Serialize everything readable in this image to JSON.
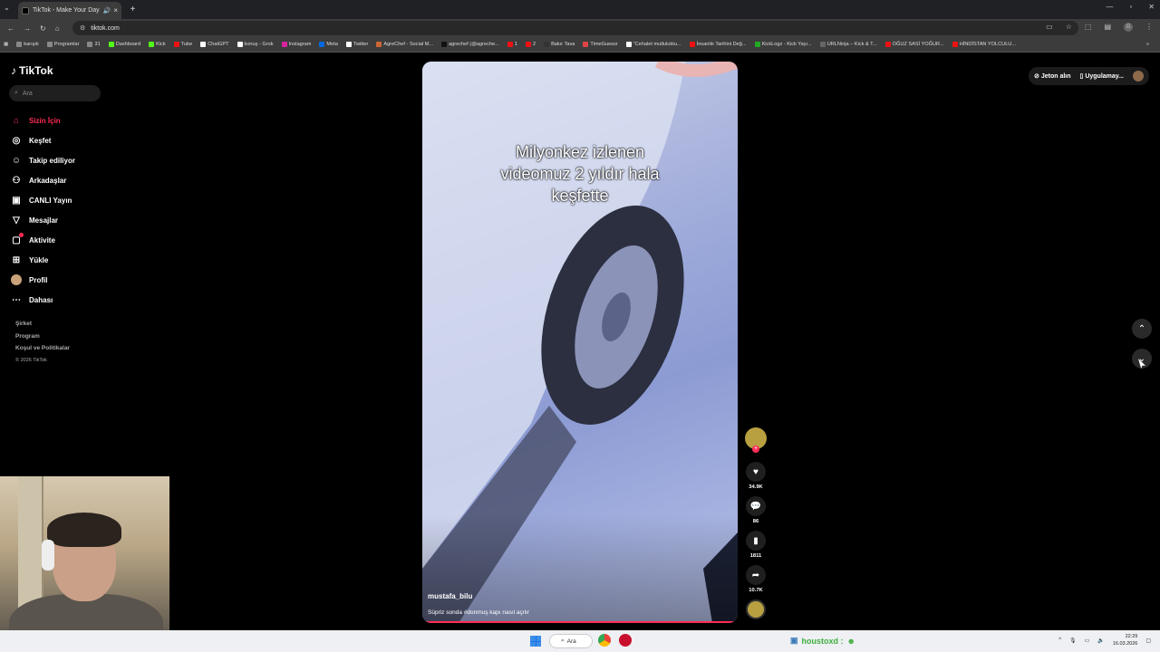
{
  "browser": {
    "tab_title": "TikTok - Make Your Day",
    "url": "tiktok.com",
    "bookmarks": [
      "karışık",
      "Programlar",
      "31",
      "Dashboard",
      "Kick",
      "Tube",
      "ChatGPT",
      "konuş - Grok",
      "Instagram",
      "Meta",
      "Twitter",
      "AgreChef - Social M...",
      "agrechef (@agreche...",
      "1",
      "2",
      "Bakır Tava",
      "TimeGuessr",
      "\"Cehalet mutluluktu...",
      "İnsanlık Tarihini Değ...",
      "KickLogz - Kick Yayı...",
      "URLNinja – Kick & T...",
      "OĞUZ SASİ YOĞUR...",
      "HİNDİSTAN YOLCULU..."
    ]
  },
  "tiktok": {
    "logo": "TikTok",
    "search_placeholder": "Ara",
    "menu": [
      {
        "label": "Sizin İçin",
        "icon": "home-icon"
      },
      {
        "label": "Keşfet",
        "icon": "compass-icon"
      },
      {
        "label": "Takip ediliyor",
        "icon": "following-icon"
      },
      {
        "label": "Arkadaşlar",
        "icon": "friends-icon"
      },
      {
        "label": "CANLI Yayın",
        "icon": "live-icon"
      },
      {
        "label": "Mesajlar",
        "icon": "messages-icon"
      },
      {
        "label": "Aktivite",
        "icon": "activity-icon"
      },
      {
        "label": "Yükle",
        "icon": "upload-icon"
      },
      {
        "label": "Profil",
        "icon": "avatar"
      },
      {
        "label": "Dahası",
        "icon": "more-icon"
      }
    ],
    "footer": {
      "company": "Şirket",
      "program": "Program",
      "terms": "Koşul ve Politikalar",
      "copyright": "© 2026 TikTok"
    },
    "top_right": {
      "coins": "Jeton alın",
      "app": "Uygulamay..."
    },
    "video": {
      "overlay_text": "Milyonkez izlenen videomuz 2 yıldır hala keşfette",
      "author": "mustafa_bilu",
      "caption": "Süpriz sonda #donmuş kapı nasıl açılır",
      "likes": "34.9K",
      "comments": "86",
      "saves": "1811",
      "shares": "10.7K"
    }
  },
  "taskbar": {
    "search": "Ara",
    "tray_text": "houstoxd :",
    "time": "22:29",
    "date": "16.03.2026"
  }
}
